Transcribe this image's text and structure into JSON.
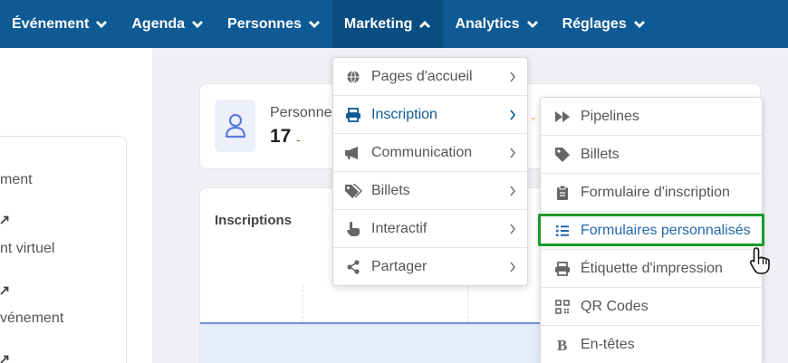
{
  "nav": {
    "items": [
      {
        "label": "Événement",
        "state": "collapsed"
      },
      {
        "label": "Agenda",
        "state": "collapsed"
      },
      {
        "label": "Personnes",
        "state": "collapsed"
      },
      {
        "label": "Marketing",
        "state": "expanded"
      },
      {
        "label": "Analytics",
        "state": "collapsed"
      },
      {
        "label": "Réglages",
        "state": "collapsed"
      }
    ]
  },
  "sidebar": {
    "items": [
      {
        "label": "ment"
      },
      {
        "label": "nt virtuel"
      },
      {
        "label": "vénement"
      }
    ]
  },
  "stats": {
    "label": "Personne",
    "value": "17",
    "delta": "-"
  },
  "chart": {
    "title": "Inscriptions"
  },
  "marketing_menu": {
    "items": [
      {
        "label": "Pages d'accueil",
        "icon": "globe-icon"
      },
      {
        "label": "Inscription",
        "icon": "printer-icon"
      },
      {
        "label": "Communication",
        "icon": "megaphone-icon"
      },
      {
        "label": "Billets",
        "icon": "tags-icon"
      },
      {
        "label": "Interactif",
        "icon": "pointer-hand-icon"
      },
      {
        "label": "Partager",
        "icon": "share-icon"
      }
    ]
  },
  "inscription_menu": {
    "items": [
      {
        "label": "Pipelines",
        "icon": "fast-forward-icon"
      },
      {
        "label": "Billets",
        "icon": "tag-icon"
      },
      {
        "label": "Formulaire d'inscription",
        "icon": "clipboard-icon"
      },
      {
        "label": "Formulaires personnalisés",
        "icon": "list-icon"
      },
      {
        "label": "Étiquette d'impression",
        "icon": "printer-icon"
      },
      {
        "label": "QR Codes",
        "icon": "qrcode-icon"
      },
      {
        "label": "En-têtes",
        "icon": "bold-icon"
      }
    ]
  },
  "colors": {
    "nav_bg": "#0e5a95",
    "nav_active_bg": "#0a4d82",
    "highlight_border": "#1a9a2a",
    "active_text": "#2367ad"
  }
}
